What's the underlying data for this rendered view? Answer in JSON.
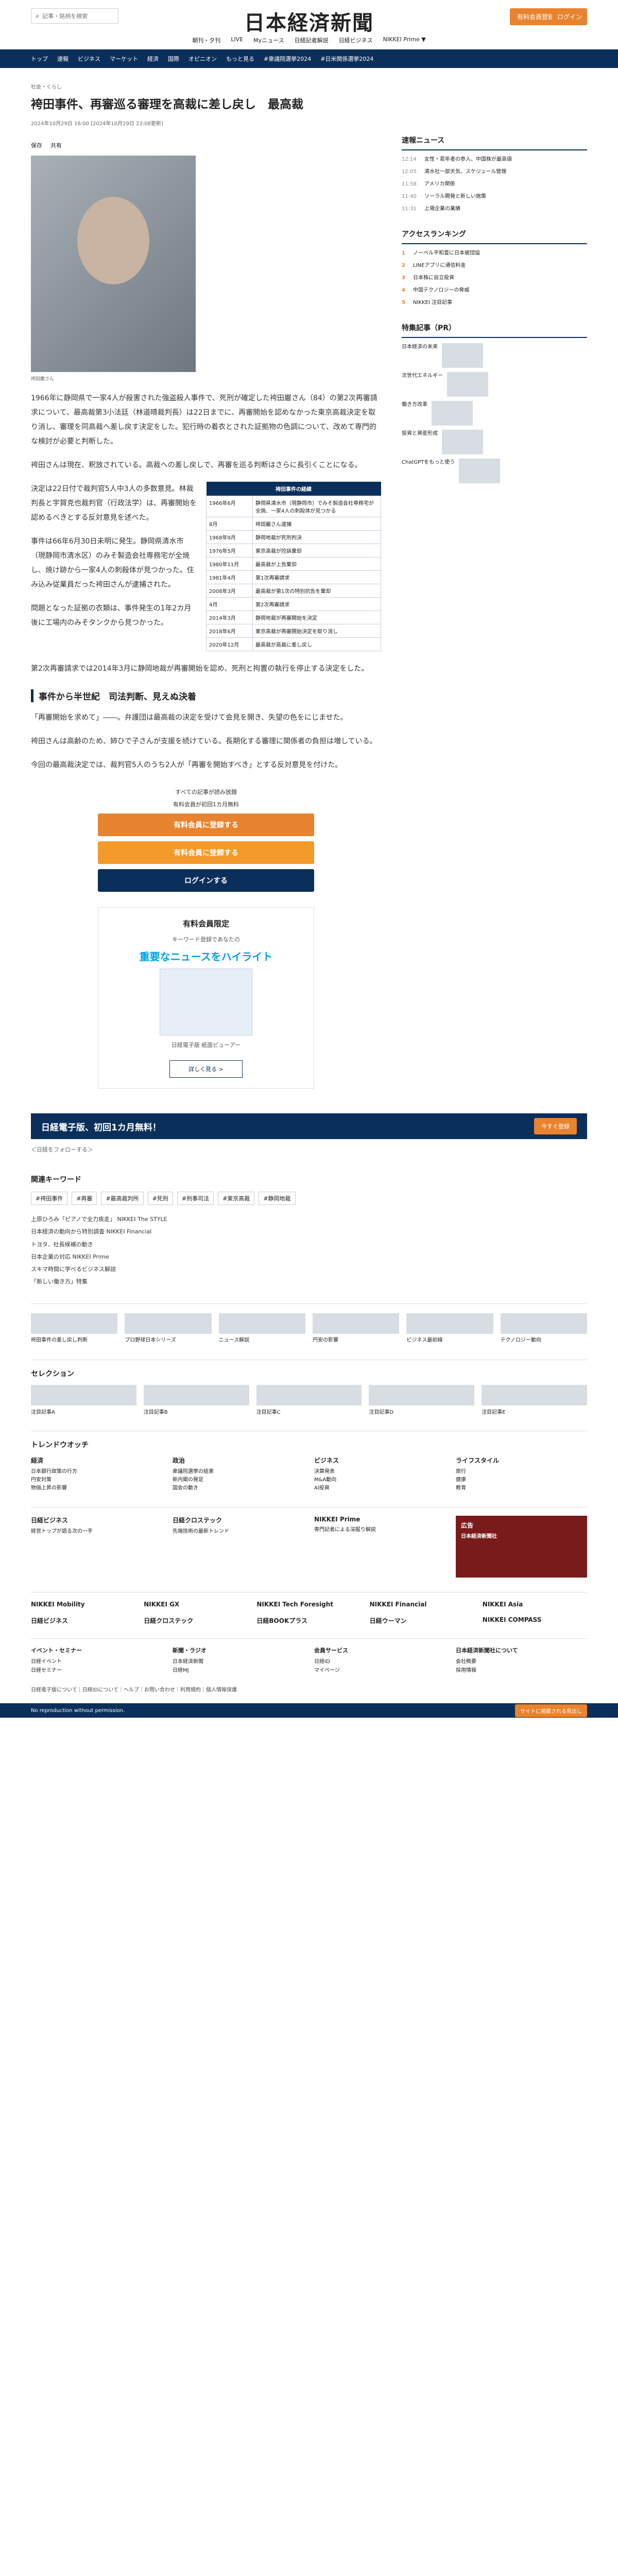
{
  "header": {
    "search_placeholder": "記事・銘柄を検索",
    "logo": "日本経済新聞",
    "subscribe": "有料会員登録",
    "login": "ログイン"
  },
  "subnav": [
    "朝刊・夕刊",
    "LIVE",
    "Myニュース",
    "日経記者解説",
    "日経ビジネス",
    "NIKKEI Prime ▼"
  ],
  "gnav": [
    "トップ",
    "速報",
    "ビジネス",
    "マーケット",
    "経済",
    "国際",
    "オピニオン",
    "もっと見る",
    "#衆議院選挙2024",
    "#日米関係選挙2024"
  ],
  "article": {
    "crumb": "社会・くらし",
    "title": "袴田事件、再審巡る審理を高裁に差し戻し　最高裁",
    "date": "2024年10月29日 16:00 [2024年10月29日 23:08更新]",
    "tools": [
      "保存",
      "共有"
    ],
    "caption": "袴田巌さん",
    "p1": "1966年に静岡県で一家4人が殺害された強盗殺人事件で、死刑が確定した袴田巌さん（84）の第2次再審請求について、最高裁第3小法廷（林道晴裁判長）は22日までに、再審開始を認めなかった東京高裁決定を取り消し、審理を同高裁へ差し戻す決定をした。犯行時の着衣とされた証拠物の色調について、改めて専門的な検討が必要と判断した。",
    "p2": "袴田さんは現在、釈放されている。高裁への差し戻しで、再審を巡る判断はさらに長引くことになる。",
    "p3": "決定は22日付で裁判官5人中3人の多数意見。林裁判長と宇賀克也裁判官（行政法学）は、再審開始を認めるべきとする反対意見を述べた。",
    "p4": "事件は66年6月30日未明に発生。静岡県清水市（現静岡市清水区）のみそ製造会社専務宅が全焼し、焼け跡から一家4人の刺殺体が見つかった。住み込み従業員だった袴田さんが逮捕された。",
    "p5": "問題となった証拠の衣類は、事件発生の1年2カ月後に工場内のみそタンクから見つかった。",
    "p6": "第2次再審請求では2014年3月に静岡地裁が再審開始を認め、死刑と拘置の執行を停止する決定をした。",
    "h2": "事件から半世紀　司法判断、見えぬ決着",
    "p7": "「再審開始を求めて」――。弁護団は最高裁の決定を受けて会見を開き、失望の色をにじませた。",
    "p8": "袴田さんは高齢のため、姉ひで子さんが支援を続けている。長期化する審理に関係者の負担は増している。",
    "p9": "今回の最高裁決定では、裁判官5人のうち2人が「再審を開始すべき」とする反対意見を付けた。"
  },
  "timeline": {
    "title": "袴田事件の経緯",
    "rows": [
      [
        "1966年6月",
        "静岡県清水市（現静岡市）でみそ製造会社専務宅が全焼、一家4人の刺殺体が見つかる"
      ],
      [
        "8月",
        "袴田巌さん逮捕"
      ],
      [
        "1968年9月",
        "静岡地裁が死刑判決"
      ],
      [
        "1976年5月",
        "東京高裁が控訴棄却"
      ],
      [
        "1980年11月",
        "最高裁が上告棄却"
      ],
      [
        "1981年4月",
        "第1次再審請求"
      ],
      [
        "2008年3月",
        "最高裁が第1次の特別抗告を棄却"
      ],
      [
        "4月",
        "第2次再審請求"
      ],
      [
        "2014年3月",
        "静岡地裁が再審開始を決定"
      ],
      [
        "2018年6月",
        "東京高裁が再審開始決定を取り消し"
      ],
      [
        "2020年12月",
        "最高裁が高裁に差し戻し"
      ]
    ]
  },
  "cta": {
    "lead": "すべての記事が読み放題",
    "sub": "有料会員が初回1カ月無料",
    "btn1": "有料会員に登録する",
    "btn2": "有料会員に登録する",
    "btn3": "ログインする"
  },
  "promo": {
    "title": "有料会員限定",
    "sub": "キーワード登録であなたの",
    "hl": "重要なニュースをハイライト",
    "cap": "日経電子版 紙面ビューアー",
    "more": "詳しく見る >"
  },
  "banner": {
    "left": "日経電子版、初回1カ月無料！",
    "right": "今すぐ登録"
  },
  "share": "＜日経をフォローする＞",
  "keywords": {
    "title": "関連キーワード",
    "tags": [
      "#袴田事件",
      "#再審",
      "#最高裁判所",
      "#死刑",
      "#刑事司法",
      "#東京高裁",
      "#静岡地裁"
    ]
  },
  "links": [
    "上原ひろみ「ピアノで全力疾走」 NIKKEI The STYLE",
    "日本経済の動向から特別調査 NIKKEI Financial",
    "トヨタ、社長候補の動き",
    "日本企業の対応 NIKKEI Prime",
    "スキマ時間に学べるビジネス解説",
    "「新しい働き方」特集"
  ],
  "cards": [
    "袴田事件の差し戻し判断",
    "プロ野球日本シリーズ",
    "ニュース解説",
    "円安の影響",
    "ビジネス最前線",
    "テクノロジー動向"
  ],
  "selection": {
    "title": "セレクション",
    "items": [
      "注目記事A",
      "注目記事B",
      "注目記事C",
      "注目記事D",
      "注目記事E"
    ]
  },
  "trend": {
    "title": "トレンドウオッチ",
    "cols": [
      {
        "h": "経済",
        "items": [
          "日本銀行政策の行方",
          "円安対策",
          "物価上昇の影響"
        ]
      },
      {
        "h": "政治",
        "items": [
          "衆議院選挙の結果",
          "新内閣の発足",
          "国会の動き"
        ]
      },
      {
        "h": "ビジネス",
        "items": [
          "決算発表",
          "M&A動向",
          "AI投資"
        ]
      },
      {
        "h": "ライフスタイル",
        "items": [
          "旅行",
          "健康",
          "教育"
        ]
      }
    ]
  },
  "media": {
    "cols": [
      {
        "h": "日経ビジネス",
        "t": "経営トップが語る次の一手"
      },
      {
        "h": "日経クロステック",
        "t": "先端技術の最新トレンド"
      },
      {
        "h": "NIKKEI Prime",
        "t": "専門記者による深掘り解説"
      },
      {
        "h": "広告",
        "t": "日本経済新聞社"
      }
    ]
  },
  "logos": [
    "NIKKEI Mobility",
    "NIKKEI GX",
    "NIKKEI Tech Foresight",
    "NIKKEI Financial",
    "NIKKEI Asia",
    "日経ビジネス",
    "日経クロステック",
    "日経BOOKプラス",
    "日経ウーマン",
    "NIKKEI COMPASS"
  ],
  "footer": [
    {
      "h": "イベント・セミナー",
      "items": [
        "日経イベント",
        "日経セミナー"
      ]
    },
    {
      "h": "新聞・ラジオ",
      "items": [
        "日本経済新聞",
        "日経MJ"
      ]
    },
    {
      "h": "会員サービス",
      "items": [
        "日経ID",
        "マイページ"
      ]
    },
    {
      "h": "日本経済新聞社について",
      "items": [
        "会社概要",
        "採用情報"
      ]
    }
  ],
  "bottom": "日経電子版について｜日経IDについて｜ヘルプ｜お問い合わせ｜利用規約｜個人情報保護",
  "fbar": {
    "left": "No reproduction without permission.",
    "right": "サイトに掲載される見出し"
  },
  "side": {
    "breaking": {
      "title": "速報ニュース",
      "items": [
        [
          "12:14",
          "女性・若年者の参入、中国株が最高値"
        ],
        [
          "12:05",
          "清水社一部天気、スケジュール管理"
        ],
        [
          "11:58",
          "アメリカ関係"
        ],
        [
          "11:40",
          "ソーラル開発と新しい施策"
        ],
        [
          "11:31",
          "上場企業の業績"
        ]
      ]
    },
    "ranking": {
      "title": "アクセスランキング",
      "items": [
        "ノーベル平和賞に日本被団協",
        "LINEアプリに通信料金",
        "日本株に自立投資",
        "中国テクノロジーの脅威",
        "NIKKEI 注目記事"
      ]
    },
    "pr": {
      "title": "特集記事（PR）",
      "items": [
        "日本経済の未来",
        "次世代エネルギー",
        "働き方改革",
        "投資と資産形成",
        "ChatGPTをもっと使う"
      ]
    }
  }
}
